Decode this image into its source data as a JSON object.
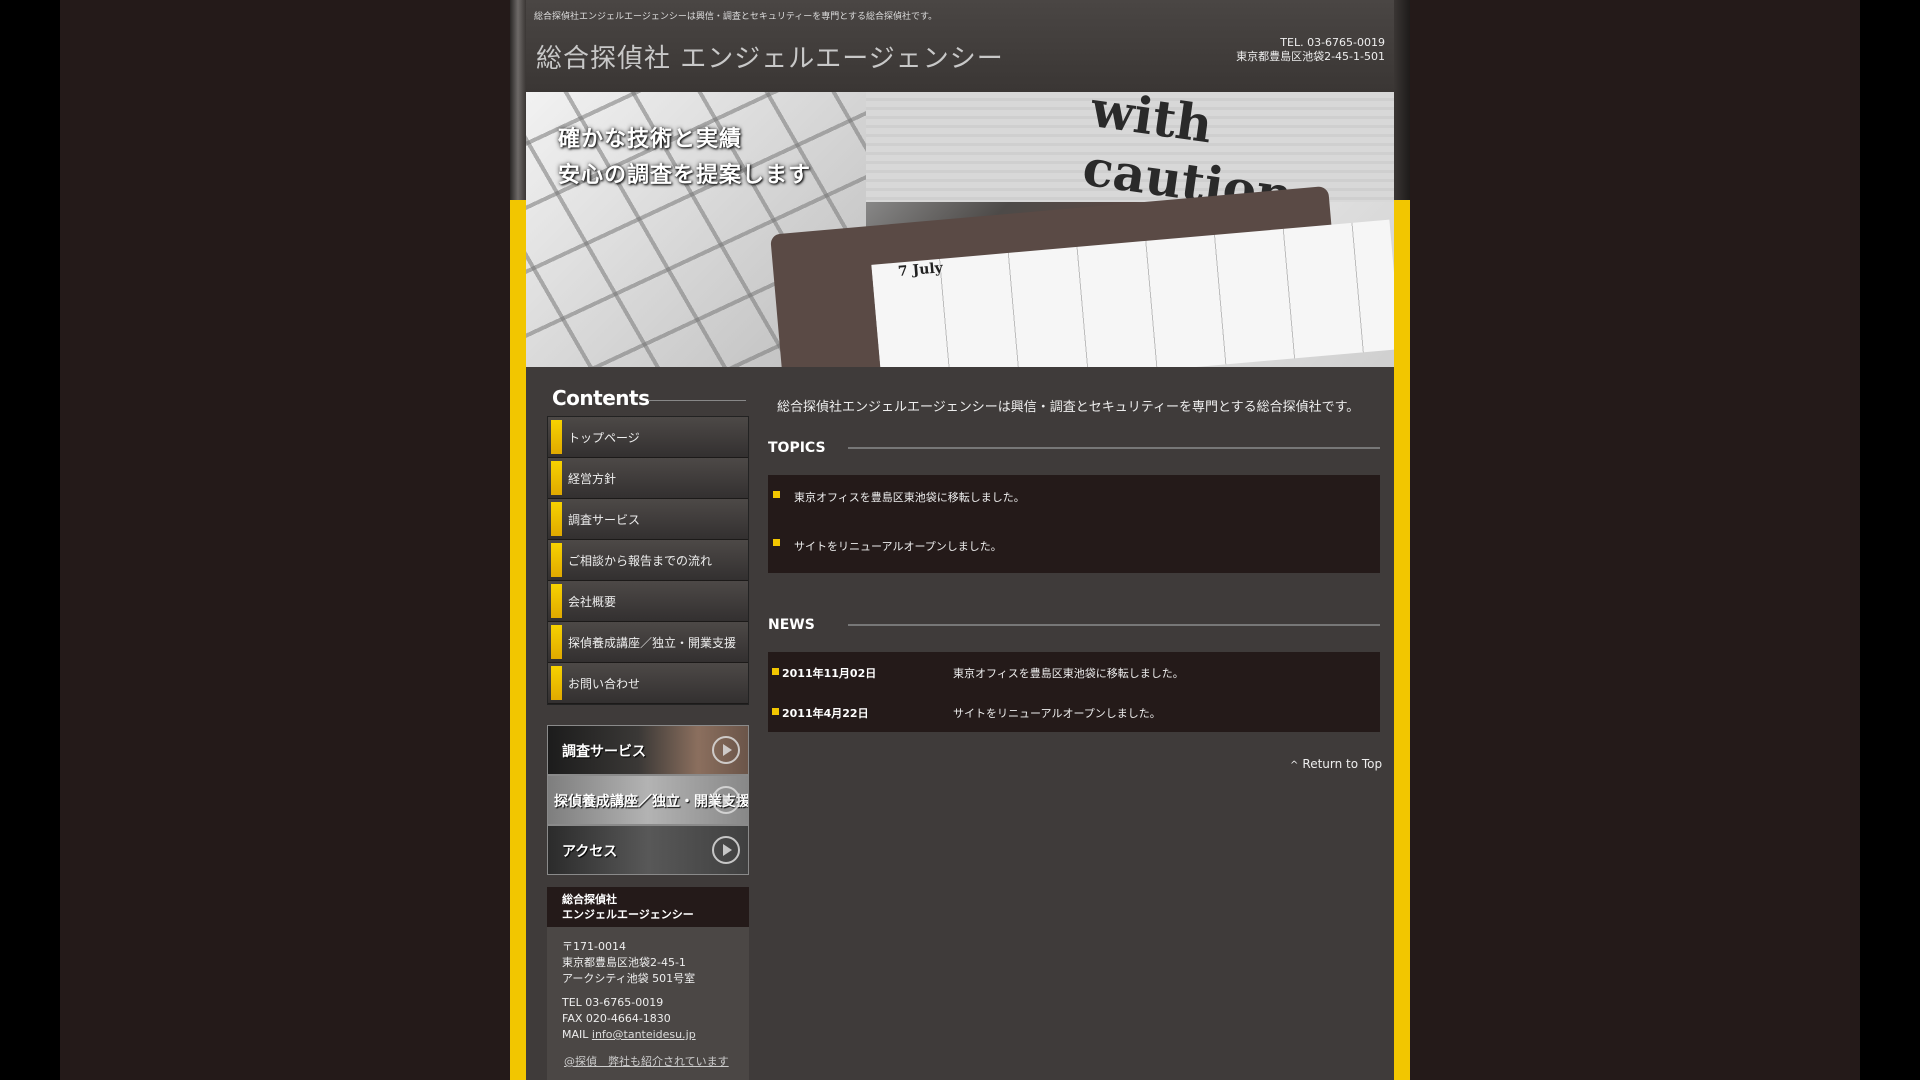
{
  "header": {
    "description": "総合探偵社エンジェルエージェンシーは興信・調査とセキュリティーを専門とする総合探偵社です。",
    "site_title": "総合探偵社 エンジェルエージェンシー",
    "tel": "TEL. 03-6765-0019",
    "address": "東京都豊島区池袋2-45-1-501"
  },
  "hero": {
    "tagline_line1": "確かな技術と実績",
    "tagline_line2": "安心の調査を提案します",
    "paper_text": "with caution",
    "calendar_date": "7 July"
  },
  "sidebar": {
    "contents_title": "Contents",
    "nav": [
      {
        "label": "トップページ"
      },
      {
        "label": "経営方針"
      },
      {
        "label": "調査サービス"
      },
      {
        "label": "ご相談から報告までの流れ"
      },
      {
        "label": "会社概要"
      },
      {
        "label": "探偵養成講座／独立・開業支援"
      },
      {
        "label": "お問い合わせ"
      }
    ],
    "banners": [
      {
        "label": "調査サービス"
      },
      {
        "label": "探偵養成講座／独立・開業支援"
      },
      {
        "label": "アクセス"
      }
    ],
    "info": {
      "name_line1": "総合探偵社",
      "name_line2": "エンジェルエージェンシー",
      "postal": "〒171-0014",
      "addr1": "東京都豊島区池袋2-45-1",
      "addr2": "アークシティ池袋 501号室",
      "tel": "TEL 03-6765-0019",
      "fax": "FAX 020-4664-1830",
      "mail_label": "MAIL ",
      "mail": "info@tanteidesu.jp",
      "link": "@探偵　弊社も紹介されています"
    }
  },
  "main": {
    "intro": "総合探偵社エンジェルエージェンシーは興信・調査とセキュリティーを専門とする総合探偵社です。",
    "topics_title": "TOPICS",
    "topics": [
      "東京オフィスを豊島区東池袋に移転しました。",
      "サイトをリニューアルオープンしました。"
    ],
    "news_title": "NEWS",
    "news": [
      {
        "date": "2011年11月02日",
        "text": "東京オフィスを豊島区東池袋に移転しました。"
      },
      {
        "date": "2011年4月22日",
        "text": "サイトをリニューアルオープンしました。"
      }
    ],
    "return_label": "Return to Top"
  }
}
